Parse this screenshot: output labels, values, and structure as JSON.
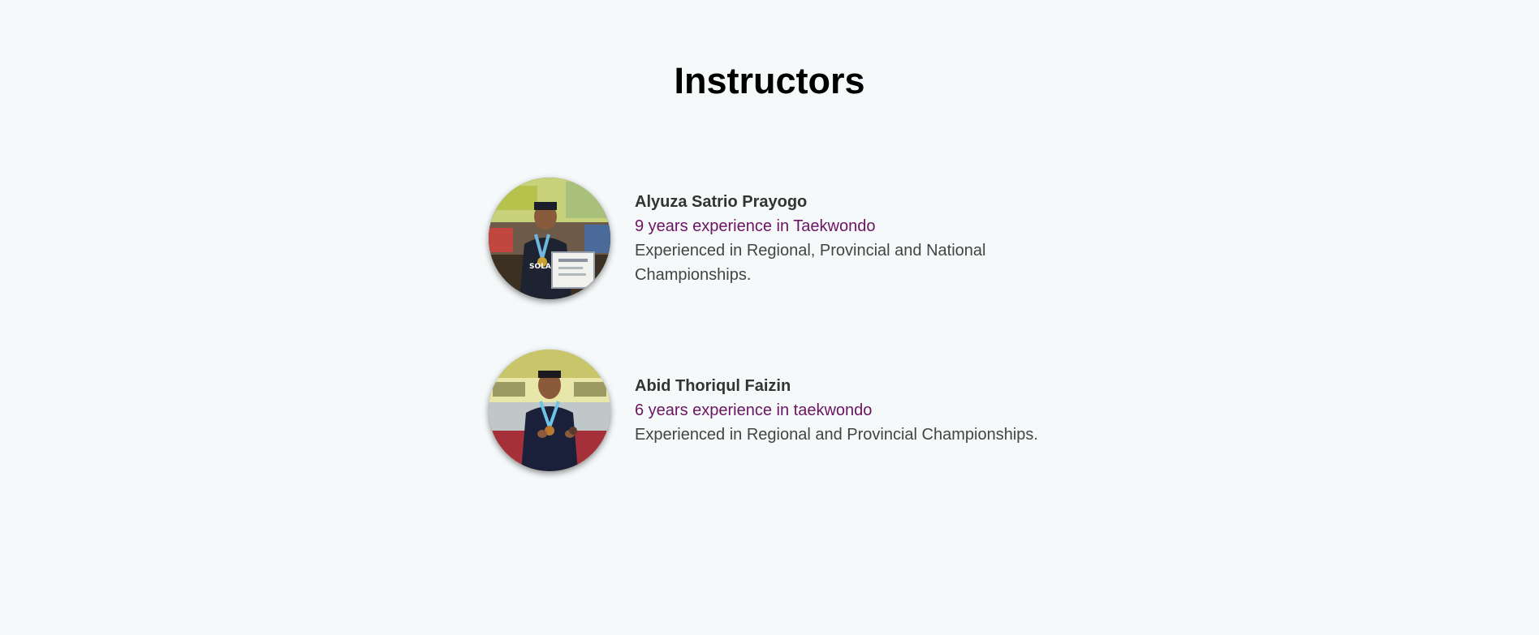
{
  "section": {
    "title": "Instructors"
  },
  "instructors": [
    {
      "name": "Alyuza Satrio Prayogo",
      "experience": "9 years experience in Taekwondo",
      "bio": "Experienced in Regional, Provincial and National Championships."
    },
    {
      "name": "Abid Thoriqul Faizin",
      "experience": "6 years experience in taekwondo",
      "bio": "Experienced in Regional and Provincial Championships."
    }
  ],
  "colors": {
    "background": "#f5f9fa",
    "heading": "#000000",
    "name": "#333333",
    "experience": "#6b1463",
    "bio": "#444444"
  }
}
